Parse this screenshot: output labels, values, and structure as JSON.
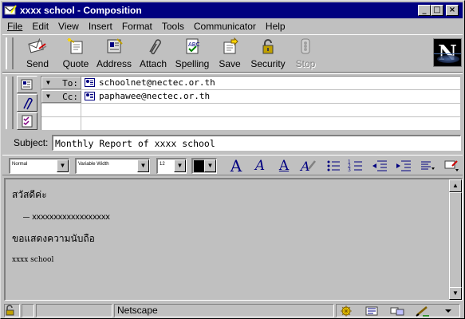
{
  "window": {
    "title": "xxxx school - Composition",
    "controls": {
      "minimize": "_",
      "maximize": "□",
      "close": "×"
    }
  },
  "menu": [
    "File",
    "Edit",
    "View",
    "Insert",
    "Format",
    "Tools",
    "Communicator",
    "Help"
  ],
  "toolbar": {
    "buttons": [
      {
        "label": "Send",
        "icon": "send-icon"
      },
      {
        "label": "Quote",
        "icon": "quote-icon"
      },
      {
        "label": "Address",
        "icon": "address-icon"
      },
      {
        "label": "Attach",
        "icon": "attach-icon"
      },
      {
        "label": "Spelling",
        "icon": "spelling-icon"
      },
      {
        "label": "Save",
        "icon": "save-icon"
      },
      {
        "label": "Security",
        "icon": "security-icon"
      },
      {
        "label": "Stop",
        "icon": "stop-icon",
        "disabled": true
      }
    ],
    "logo": "N"
  },
  "addressing": {
    "rows": [
      {
        "type": "To:",
        "address": "schoolnet@nectec.or.th"
      },
      {
        "type": "Cc:",
        "address": "paphawee@nectec.or.th"
      }
    ]
  },
  "subject": {
    "label": "Subject:",
    "value": "Monthly Report of xxxx school"
  },
  "format": {
    "paragraph_style": "Normal",
    "font": "Variable Width",
    "size": "12",
    "color": "#000000"
  },
  "message": {
    "greeting": "สวัสดีค่ะ",
    "line2": "xxxxxxxxxxxxxxxxxx",
    "thanks": "ขอแสดงความนับถือ",
    "signature": "xxxx school"
  },
  "status": {
    "text": "Netscape"
  },
  "colors": {
    "titlebar": "#000080",
    "face": "#c0c0c0"
  }
}
